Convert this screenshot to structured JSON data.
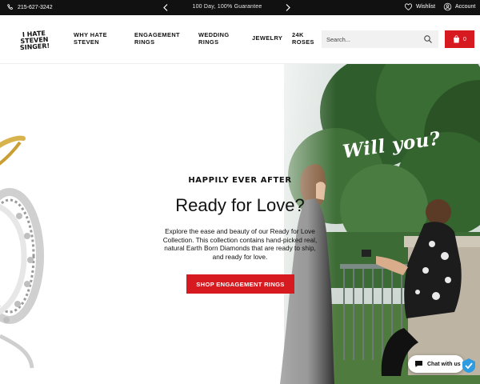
{
  "topbar": {
    "phone": "215-627-3242",
    "promo": "100 Day, 100% Guarantee",
    "wishlist_label": "Wishlist",
    "account_label": "Account"
  },
  "header": {
    "logo_line1": "I HATE",
    "logo_line2": "STEVEN SINGER!",
    "nav": [
      "WHY HATE STEVEN",
      "ENGAGEMENT RINGS",
      "WEDDING RINGS",
      "JEWELRY",
      "24K ROSES"
    ],
    "search_placeholder": "Search...",
    "cart_count": "0"
  },
  "hero": {
    "tagline": "HAPPILY EVER AFTER",
    "title": "Ready for Love?",
    "description": "Explore the ease and beauty of our Ready for Love Collection. This collection contains hand-picked real, natural Earth Born Diamonds that are ready to ship, and ready for love.",
    "cta_label": "SHOP ENGAGEMENT RINGS",
    "overlay_text": "Will you?"
  },
  "chat": {
    "label": "Chat with us"
  },
  "colors": {
    "accent_red": "#d71920",
    "topbar_bg": "#111111"
  },
  "icons": {
    "phone": "phone-icon",
    "prev": "chevron-left-icon",
    "next": "chevron-right-icon",
    "wishlist": "heart-icon",
    "account": "user-icon",
    "search": "search-icon",
    "cart": "shopping-bag-icon",
    "chat": "chat-bubble-icon"
  }
}
